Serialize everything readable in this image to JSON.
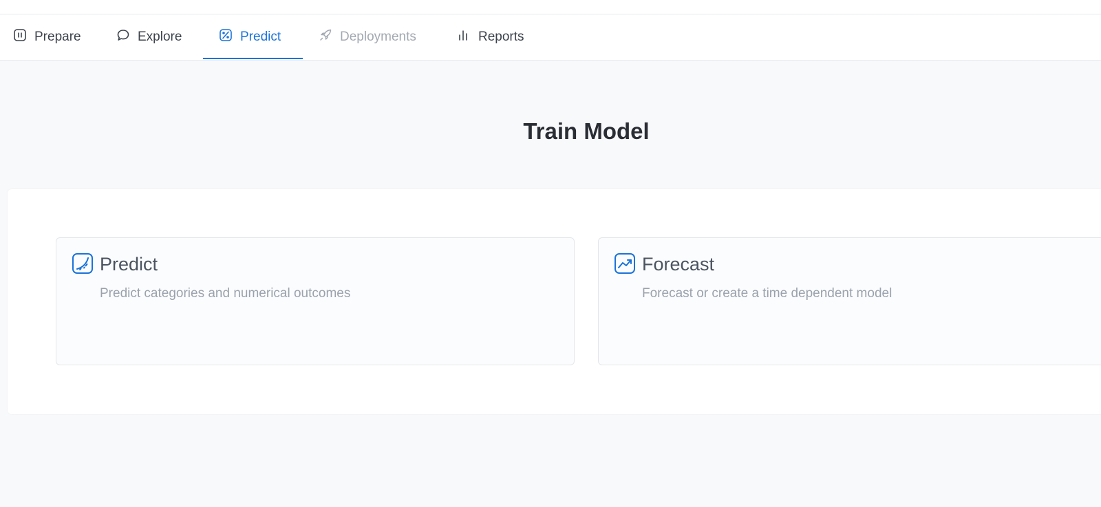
{
  "tabs": [
    {
      "label": "Prepare",
      "icon": "pause-square-icon",
      "state": "normal"
    },
    {
      "label": "Explore",
      "icon": "chat-bubble-icon",
      "state": "normal"
    },
    {
      "label": "Predict",
      "icon": "predict-icon",
      "state": "active"
    },
    {
      "label": "Deployments",
      "icon": "rocket-icon",
      "state": "disabled"
    },
    {
      "label": "Reports",
      "icon": "bar-chart-icon",
      "state": "normal"
    }
  ],
  "page": {
    "title": "Train Model"
  },
  "cards": [
    {
      "title": "Predict",
      "description": "Predict categories and numerical outcomes",
      "icon": "predict-icon"
    },
    {
      "title": "Forecast",
      "description": "Forecast or create a time dependent model",
      "icon": "trend-line-icon"
    }
  ],
  "colors": {
    "accent": "#1a73d9",
    "disabled": "#a3a9b2",
    "background": "#f8f9fb"
  }
}
